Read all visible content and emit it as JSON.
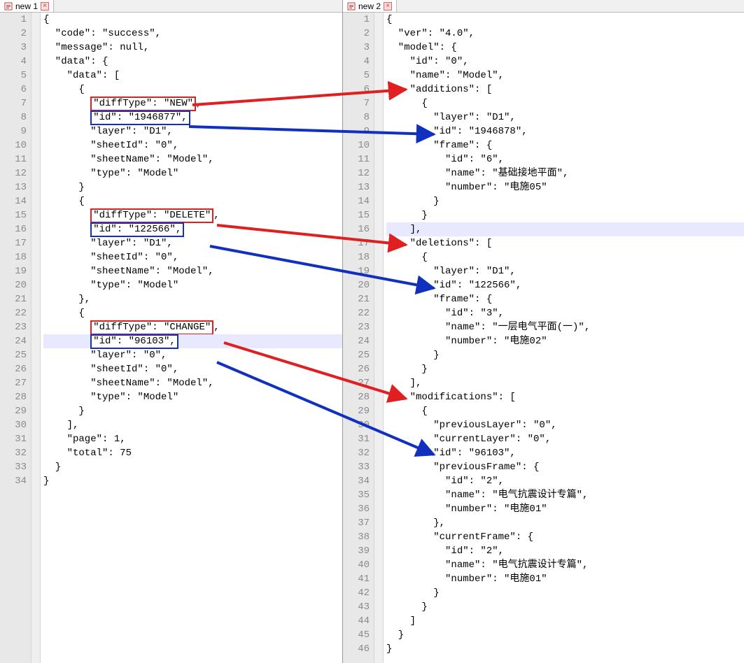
{
  "tabs": {
    "left": {
      "label": "new 1"
    },
    "right": {
      "label": "new 2"
    }
  },
  "left": {
    "lines": [
      "{",
      "  \"code\": \"success\",",
      "  \"message\": null,",
      "  \"data\": {",
      "    \"data\": [",
      "      {"
    ],
    "box1_red": "\"diffType\": \"NEW\"",
    "box1_red_after": ",",
    "box1_blue": "\"id\": \"1946877\",",
    "after1": [
      "        \"layer\": \"D1\",",
      "        \"sheetId\": \"0\",",
      "        \"sheetName\": \"Model\",",
      "        \"type\": \"Model\"",
      "      }",
      "      {"
    ],
    "box2_red": "\"diffType\": \"DELETE\"",
    "box2_red_after": ",",
    "box2_blue": "\"id\": \"122566\",",
    "after2": [
      "        \"layer\": \"D1\",",
      "        \"sheetId\": \"0\",",
      "        \"sheetName\": \"Model\",",
      "        \"type\": \"Model\"",
      "      },",
      "      {"
    ],
    "box3_red": "\"diffType\": \"CHANGE\"",
    "box3_red_after": ",",
    "box3_blue": "\"id\": \"96103\",",
    "after3": [
      "        \"layer\": \"0\",",
      "        \"sheetId\": \"0\",",
      "        \"sheetName\": \"Model\",",
      "        \"type\": \"Model\"",
      "      }",
      "    ],",
      "    \"page\": 1,",
      "    \"total\": 75",
      "  }",
      "}"
    ]
  },
  "right": {
    "lines": [
      "{",
      "  \"ver\": \"4.0\",",
      "  \"model\": {",
      "    \"id\": \"0\",",
      "    \"name\": \"Model\",",
      "    \"additions\": [",
      "      {",
      "        \"layer\": \"D1\",",
      "        \"id\": \"1946878\",",
      "        \"frame\": {",
      "          \"id\": \"6\",",
      "          \"name\": \"基础接地平面\",",
      "          \"number\": \"电施05\"",
      "        }",
      "      }",
      "    ],",
      "    \"deletions\": [",
      "      {",
      "        \"layer\": \"D1\",",
      "        \"id\": \"122566\",",
      "        \"frame\": {",
      "          \"id\": \"3\",",
      "          \"name\": \"一层电气平面(一)\",",
      "          \"number\": \"电施02\"",
      "        }",
      "      }",
      "    ],",
      "    \"modifications\": [",
      "      {",
      "        \"previousLayer\": \"0\",",
      "        \"currentLayer\": \"0\",",
      "        \"id\": \"96103\",",
      "        \"previousFrame\": {",
      "          \"id\": \"2\",",
      "          \"name\": \"电气抗震设计专篇\",",
      "          \"number\": \"电施01\"",
      "        },",
      "        \"currentFrame\": {",
      "          \"id\": \"2\",",
      "          \"name\": \"电气抗震设计专篇\",",
      "          \"number\": \"电施01\"",
      "        }",
      "      }",
      "    ]",
      "  }",
      "}"
    ]
  },
  "colors": {
    "red": "#e02020",
    "blue": "#1030c0"
  }
}
